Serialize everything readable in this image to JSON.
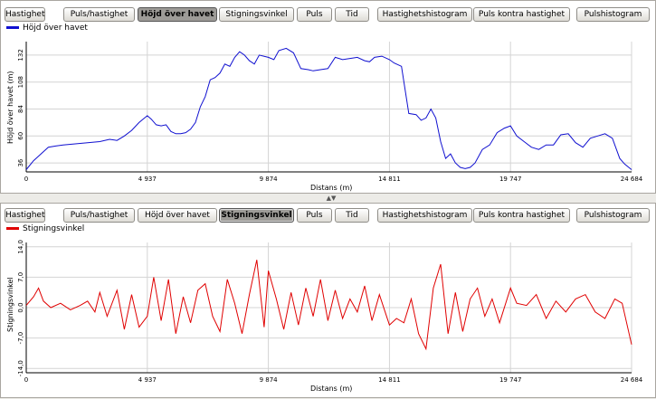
{
  "toolbar": {
    "buttons": [
      "Hastighet",
      "Puls/hastighet",
      "Höjd över havet",
      "Stigningsvinkel",
      "Puls",
      "Tid",
      "Hastighetshistogram",
      "Puls kontra hastighet",
      "Pulshistogram"
    ]
  },
  "colors": {
    "elevation": "#1010d0",
    "slope": "#e00000",
    "grid": "#d4d4d4"
  },
  "splitter_icon": "▲▼",
  "chart_data": [
    {
      "type": "line",
      "active_button": "Höjd över havet",
      "series": [
        {
          "name": "Höjd över havet",
          "x": [
            0,
            300,
            600,
            900,
            1200,
            1500,
            2000,
            2500,
            3000,
            3400,
            3700,
            4000,
            4300,
            4600,
            4937,
            5100,
            5300,
            5500,
            5700,
            5900,
            6100,
            6300,
            6500,
            6700,
            6900,
            7100,
            7300,
            7500,
            7700,
            7900,
            8100,
            8300,
            8500,
            8700,
            8900,
            9100,
            9300,
            9500,
            9874,
            10100,
            10300,
            10600,
            10900,
            11200,
            11500,
            11700,
            12000,
            12300,
            12600,
            12900,
            13200,
            13500,
            13800,
            14000,
            14200,
            14500,
            14811,
            15000,
            15300,
            15600,
            15900,
            16100,
            16300,
            16500,
            16700,
            16900,
            17100,
            17300,
            17500,
            17700,
            17900,
            18100,
            18300,
            18600,
            18900,
            19200,
            19500,
            19747,
            20000,
            20300,
            20600,
            20900,
            21200,
            21500,
            21800,
            22100,
            22400,
            22700,
            23000,
            23300,
            23600,
            23900,
            24200,
            24400,
            24684
          ],
          "y": [
            30,
            38,
            44,
            50,
            51,
            52,
            53,
            54,
            55,
            57,
            56,
            60,
            65,
            72,
            78,
            75,
            70,
            69,
            70,
            64,
            62,
            62,
            63,
            66,
            72,
            86,
            95,
            110,
            112,
            116,
            124,
            122,
            130,
            135,
            132,
            127,
            124,
            132,
            130,
            128,
            136,
            138,
            134,
            120,
            119,
            118,
            119,
            120,
            130,
            128,
            129,
            130,
            127,
            126,
            130,
            131,
            128,
            125,
            122,
            80,
            79,
            74,
            76,
            84,
            76,
            55,
            40,
            44,
            36,
            32,
            31,
            32,
            36,
            48,
            52,
            63,
            67,
            69,
            60,
            55,
            50,
            48,
            52,
            52,
            61,
            62,
            54,
            50,
            58,
            60,
            62,
            58,
            40,
            35,
            30
          ]
        }
      ],
      "xlabel": "Distans (m)",
      "ylabel": "Höjd över havet (m)",
      "xticks": [
        0,
        4937,
        9874,
        14811,
        19747,
        24684
      ],
      "xtick_labels": [
        "0",
        "4 937",
        "9 874",
        "14 811",
        "19 747",
        "24 684"
      ],
      "yticks": [
        36,
        60,
        84,
        108,
        132
      ],
      "xlim": [
        0,
        24684
      ],
      "ylim": [
        28,
        144
      ],
      "grid": true,
      "legend": "top-left"
    },
    {
      "type": "line",
      "active_button": "Stigningsvinkel",
      "series": [
        {
          "name": "Stigningsvinkel",
          "x": [
            0,
            300,
            500,
            700,
            1000,
            1400,
            1800,
            2200,
            2500,
            2800,
            3000,
            3300,
            3700,
            4000,
            4300,
            4600,
            4937,
            5200,
            5500,
            5800,
            6100,
            6400,
            6700,
            7000,
            7300,
            7600,
            7900,
            8200,
            8500,
            8800,
            9100,
            9400,
            9700,
            9874,
            10200,
            10500,
            10800,
            11100,
            11400,
            11700,
            12000,
            12300,
            12600,
            12900,
            13200,
            13500,
            13800,
            14100,
            14400,
            14811,
            15100,
            15400,
            15700,
            16000,
            16300,
            16600,
            16900,
            17200,
            17500,
            17800,
            18100,
            18400,
            18700,
            19000,
            19300,
            19747,
            20000,
            20400,
            20800,
            21200,
            21600,
            22000,
            22400,
            22800,
            23200,
            23600,
            24000,
            24300,
            24684
          ],
          "y": [
            0.5,
            2.5,
            4.5,
            1.5,
            0.0,
            1.0,
            -0.5,
            0.5,
            1.5,
            -1.0,
            3.5,
            -2.0,
            4.0,
            -5.0,
            3.0,
            -4.5,
            -2.0,
            7.0,
            -3.0,
            6.5,
            -6.0,
            2.5,
            -3.5,
            4.0,
            5.5,
            -2.0,
            -5.5,
            6.5,
            1.0,
            -6.0,
            3.0,
            11.0,
            -4.5,
            8.5,
            2.0,
            -5.0,
            3.5,
            -4.0,
            4.5,
            -2.0,
            6.5,
            -3.0,
            4.0,
            -2.5,
            2.0,
            -1.0,
            5.0,
            -3.0,
            3.0,
            -4.0,
            -2.5,
            -3.5,
            2.0,
            -6.0,
            -9.5,
            4.5,
            10.0,
            -6.0,
            3.5,
            -5.5,
            2.0,
            4.5,
            -2.0,
            2.0,
            -3.5,
            4.5,
            1.0,
            0.5,
            3.0,
            -2.5,
            1.5,
            -1.0,
            2.0,
            3.0,
            -1.0,
            -2.5,
            2.0,
            1.0,
            -8.5
          ]
        }
      ],
      "xlabel": "Distans (m)",
      "ylabel": "Stigningsvinkel",
      "xticks": [
        0,
        4937,
        9874,
        14811,
        19747,
        24684
      ],
      "xtick_labels": [
        "0",
        "4 937",
        "9 874",
        "14 811",
        "19 747",
        "24 684"
      ],
      "yticks": [
        -14,
        -7,
        0,
        7,
        14
      ],
      "ytick_labels": [
        "-14,0",
        "-7,0",
        "0,0",
        "7,0",
        "14,0"
      ],
      "xlim": [
        0,
        24684
      ],
      "ylim": [
        -15,
        15
      ],
      "grid": true,
      "legend": "top-left"
    }
  ]
}
